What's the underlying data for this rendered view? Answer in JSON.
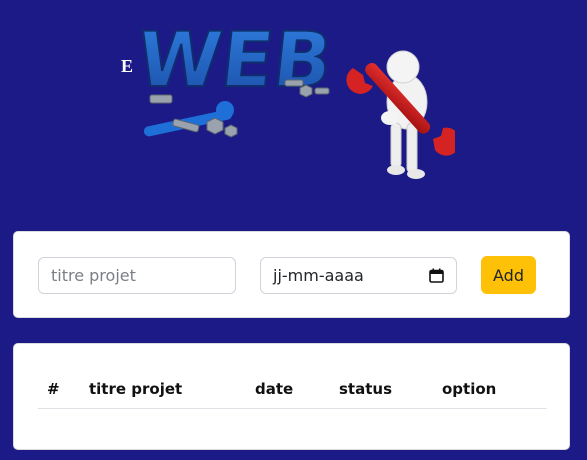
{
  "banner": {
    "logo_text": "WEB",
    "small_text": "E",
    "icon": "web-maintenance-illustration"
  },
  "form": {
    "title_placeholder": "titre projet",
    "date_placeholder": "jj-mm-aaaa",
    "date_icon": "calendar-icon",
    "add_label": "Add",
    "add_color": "#ffc107"
  },
  "table": {
    "headers": [
      "#",
      "titre projet",
      "date",
      "status",
      "option"
    ],
    "rows": []
  },
  "colors": {
    "background": "#1c1a87",
    "card": "#ffffff"
  }
}
